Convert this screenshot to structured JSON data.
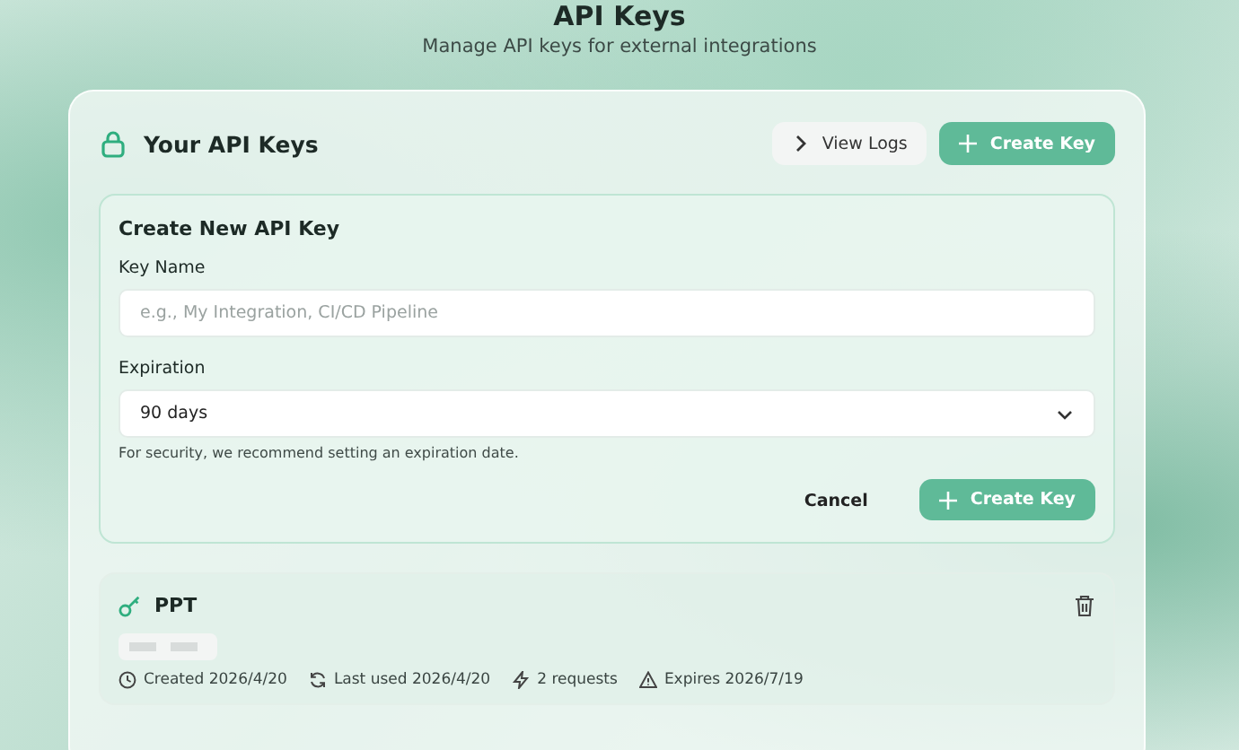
{
  "page": {
    "title": "API Keys",
    "subtitle": "Manage API keys for external integrations"
  },
  "header": {
    "title": "Your API Keys",
    "buttons": [
      {
        "kind": "secondary",
        "label": "View Logs"
      },
      {
        "kind": "primary",
        "label": "Create Key"
      }
    ]
  },
  "form": {
    "title": "Create New API Key",
    "fields": [
      {
        "kind": "text",
        "label": "Key Name",
        "placeholder": "e.g., My Integration, CI/CD Pipeline"
      },
      {
        "kind": "select",
        "label": "Expiration",
        "value": "90 days",
        "hint": "For security, we recommend setting an expiration date."
      }
    ],
    "actions": [
      {
        "kind": "secondary",
        "label": "Cancel"
      },
      {
        "kind": "primary",
        "label": "Create Key"
      }
    ]
  },
  "keys": [
    {
      "name": "PPT",
      "meta": [
        {
          "kind": "created",
          "text": "Created 2026/4/20"
        },
        {
          "kind": "used",
          "text": "Last used 2026/4/20"
        },
        {
          "kind": "requests",
          "text": "2 requests"
        },
        {
          "kind": "expires",
          "text": "Expires 2026/7/19"
        }
      ]
    }
  ]
}
